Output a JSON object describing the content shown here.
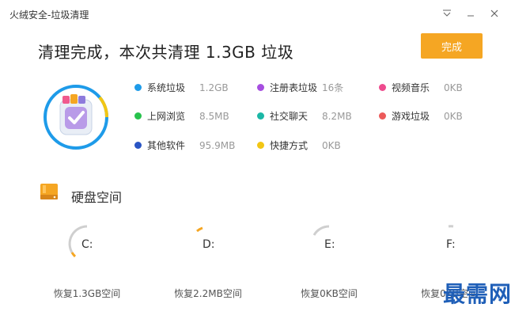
{
  "window": {
    "title": "火绒安全-垃圾清理",
    "controls": [
      "menu-icon",
      "minimize-icon",
      "close-icon"
    ]
  },
  "summary": {
    "headline": "清理完成，本次共清理 1.3GB 垃圾",
    "done_label": "完成"
  },
  "colors": {
    "accent": "#f5a623",
    "ring_blue": "#1e9be9",
    "ring_yellow": "#f2c614",
    "watermark": "#1f5fb8"
  },
  "categories": [
    {
      "label": "系统垃圾",
      "value": "1.2GB",
      "color": "#1e9be9"
    },
    {
      "label": "注册表垃圾",
      "value": "16条",
      "color": "#a64ee0"
    },
    {
      "label": "视频音乐",
      "value": "0KB",
      "color": "#ee4b8e"
    },
    {
      "label": "上网浏览",
      "value": "8.5MB",
      "color": "#27c24c"
    },
    {
      "label": "社交聊天",
      "value": "8.2MB",
      "color": "#1bb7a6"
    },
    {
      "label": "游戏垃圾",
      "value": "0KB",
      "color": "#ec5a5a"
    },
    {
      "label": "其他软件",
      "value": "95.9MB",
      "color": "#2a55c4"
    },
    {
      "label": "快捷方式",
      "value": "0KB",
      "color": "#f2c614"
    }
  ],
  "disk": {
    "title": "硬盘空间",
    "drives": [
      {
        "letter": "C:",
        "caption": "恢复1.3GB空间"
      },
      {
        "letter": "D:",
        "caption": "恢复2.2MB空间"
      },
      {
        "letter": "E:",
        "caption": "恢复0KB空间"
      },
      {
        "letter": "F:",
        "caption": "恢复0KB空间"
      }
    ]
  },
  "watermark": "最需网"
}
